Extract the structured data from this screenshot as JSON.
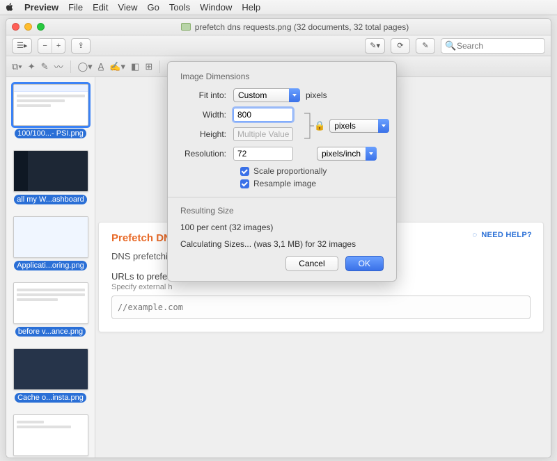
{
  "menubar": {
    "app": "Preview",
    "items": [
      "File",
      "Edit",
      "View",
      "Go",
      "Tools",
      "Window",
      "Help"
    ]
  },
  "window": {
    "title": "prefetch dns requests.png (32 documents, 32 total pages)"
  },
  "toolbar1": {
    "search_placeholder": "Search"
  },
  "sidebar": {
    "thumbs": [
      {
        "label": "100/100...- PSI.png",
        "selected": true
      },
      {
        "label": "all my W...ashboard",
        "selected": false
      },
      {
        "label": "Applicati...oring.png",
        "selected": false
      },
      {
        "label": "before v...ance.png",
        "selected": false
      },
      {
        "label": "Cache o...insta.png",
        "selected": false
      },
      {
        "label": "",
        "selected": false
      }
    ]
  },
  "doc": {
    "title": "Prefetch DNS Re",
    "desc": "DNS prefetching ca",
    "field_label": "URLs to prefet",
    "field_desc": "Specify external h",
    "placeholder": "//example.com",
    "need_help": "NEED HELP?"
  },
  "modal": {
    "section1_title": "Image Dimensions",
    "fit_label": "Fit into:",
    "fit_value": "Custom",
    "fit_suffix": "pixels",
    "width_label": "Width:",
    "width_value": "800",
    "height_label": "Height:",
    "height_value": "Multiple Values",
    "wh_unit": "pixels",
    "resolution_label": "Resolution:",
    "resolution_value": "72",
    "resolution_unit": "pixels/inch",
    "scale_label": "Scale proportionally",
    "resample_label": "Resample image",
    "section2_title": "Resulting Size",
    "result_line1": "100 per cent (32 images)",
    "result_line2": "Calculating Sizes... (was 3,1 MB) for 32 images",
    "cancel": "Cancel",
    "ok": "OK"
  }
}
